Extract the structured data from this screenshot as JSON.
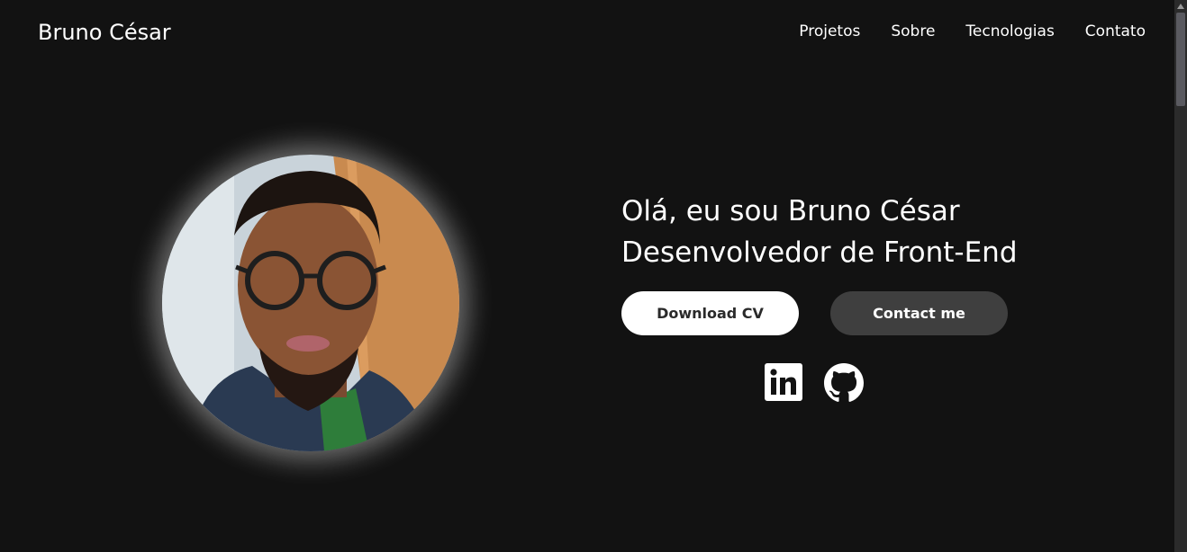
{
  "header": {
    "brand": "Bruno César",
    "nav": [
      "Projetos",
      "Sobre",
      "Tecnologias",
      "Contato"
    ]
  },
  "hero": {
    "greeting": "Olá, eu sou Bruno César",
    "role": "Desenvolvedor de Front-End",
    "download_label": "Download CV",
    "contact_label": "Contact me",
    "social": [
      {
        "icon": "linkedin-icon"
      },
      {
        "icon": "github-icon"
      }
    ]
  },
  "colors": {
    "background": "#121212",
    "primary_button": "#ffffff",
    "secondary_button": "#3f3f3f"
  }
}
